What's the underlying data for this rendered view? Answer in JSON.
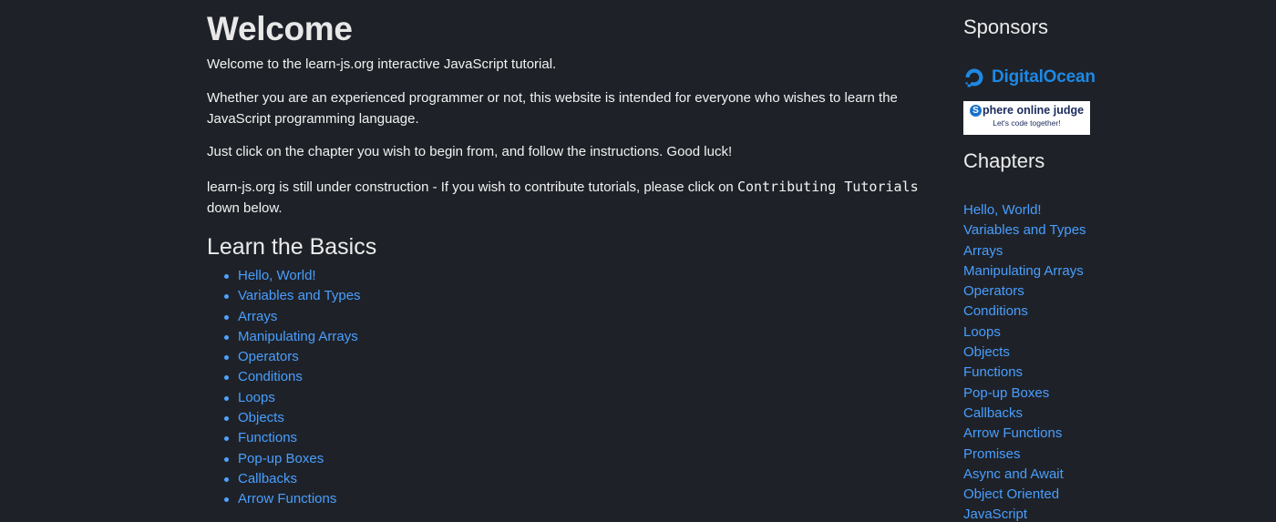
{
  "main": {
    "title": "Welcome",
    "paragraphs": [
      "Welcome to the learn-js.org interactive JavaScript tutorial.",
      "Whether you are an experienced programmer or not, this website is intended for everyone who wishes to learn the",
      "JavaScript programming language.",
      "Just click on the chapter you wish to begin from, and follow the instructions. Good luck!",
      "learn-js.org is still under construction - If you wish to contribute tutorials, please click on",
      "down below."
    ],
    "contributing_code": "Contributing Tutorials",
    "basics_title": "Learn the Basics",
    "basics": [
      "Hello, World!",
      "Variables and Types",
      "Arrays",
      "Manipulating Arrays",
      "Operators",
      "Conditions",
      "Loops",
      "Objects",
      "Functions",
      "Pop-up Boxes",
      "Callbacks",
      "Arrow Functions"
    ]
  },
  "sidebar": {
    "sponsors_title": "Sponsors",
    "digitalocean": "DigitalOcean",
    "sphere_main": "phere online judge",
    "sphere_letter": "S",
    "sphere_sub": "Let's code together!",
    "chapters_title": "Chapters",
    "chapters": [
      "Hello, World!",
      "Variables and Types",
      "Arrays",
      "Manipulating Arrays",
      "Operators",
      "Conditions",
      "Loops",
      "Objects",
      "Functions",
      "Pop-up Boxes",
      "Callbacks",
      "Arrow Functions",
      "Promises",
      "Async and Await",
      "Object Oriented",
      "JavaScript"
    ]
  },
  "colors": {
    "background": "#1e2228",
    "link": "#4a9eff",
    "brand_digitalocean": "#1e88e5"
  }
}
